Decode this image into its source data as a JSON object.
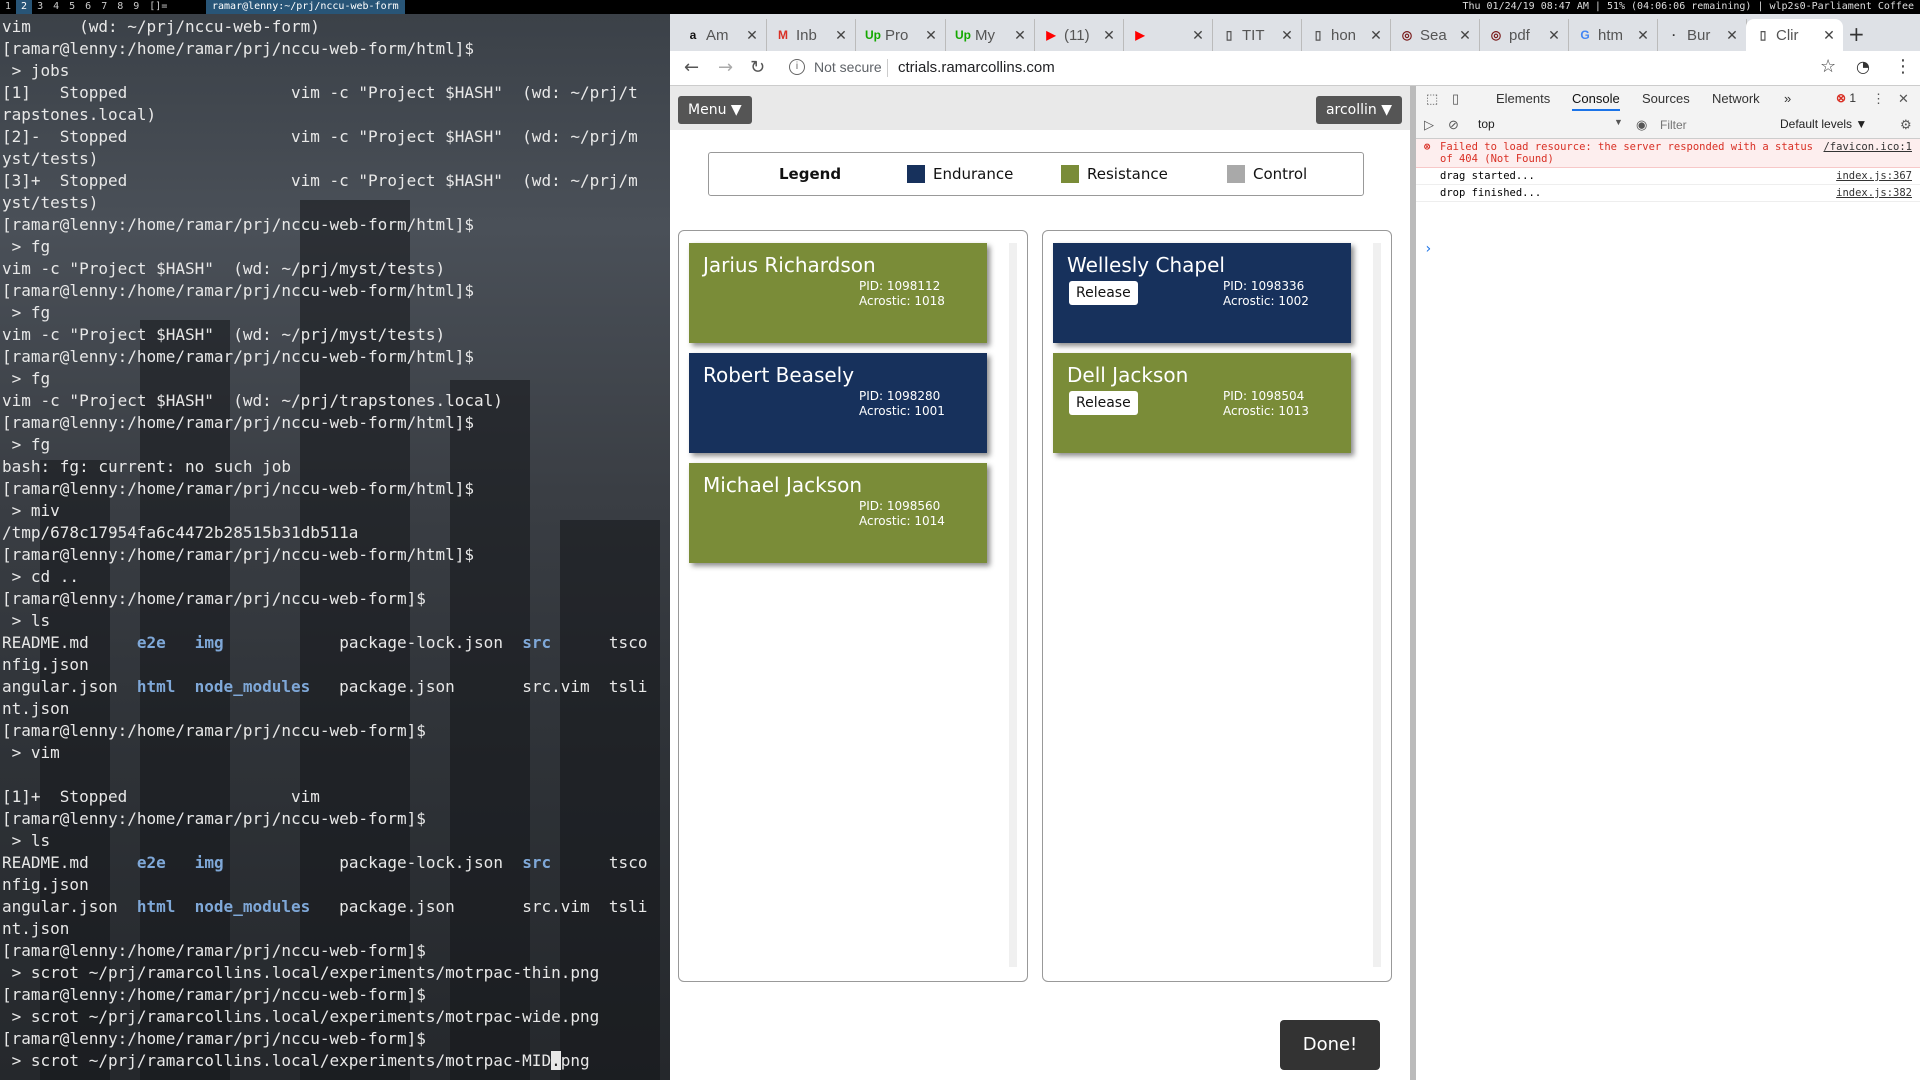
{
  "topbar": {
    "workspaces": [
      "1",
      "2",
      "3",
      "4",
      "5",
      "6",
      "7",
      "8",
      "9",
      "[]="
    ],
    "window_title": "ramar@lenny:~/prj/nccu-web-form",
    "status": "Thu 01/24/19 08:47 AM | 51% (04:06:06 remaining) | wlp2s0-Parliament Coffee"
  },
  "terminal": {
    "lines": [
      "vim     (wd: ~/prj/nccu-web-form)",
      "[ramar@lenny:/home/ramar/prj/nccu-web-form/html]$",
      " > jobs",
      "[1]   Stopped                 vim -c \"Project $HASH\"  (wd: ~/prj/t",
      "rapstones.local)",
      "[2]-  Stopped                 vim -c \"Project $HASH\"  (wd: ~/prj/m",
      "yst/tests)",
      "[3]+  Stopped                 vim -c \"Project $HASH\"  (wd: ~/prj/m",
      "yst/tests)",
      "[ramar@lenny:/home/ramar/prj/nccu-web-form/html]$",
      " > fg",
      "vim -c \"Project $HASH\"  (wd: ~/prj/myst/tests)",
      "[ramar@lenny:/home/ramar/prj/nccu-web-form/html]$",
      " > fg",
      "vim -c \"Project $HASH\"  (wd: ~/prj/myst/tests)",
      "[ramar@lenny:/home/ramar/prj/nccu-web-form/html]$",
      " > fg",
      "vim -c \"Project $HASH\"  (wd: ~/prj/trapstones.local)",
      "[ramar@lenny:/home/ramar/prj/nccu-web-form/html]$",
      " > fg",
      "bash: fg: current: no such job",
      "[ramar@lenny:/home/ramar/prj/nccu-web-form/html]$",
      " > miv",
      "/tmp/678c17954fa6c4472b28515b31db511a",
      "[ramar@lenny:/home/ramar/prj/nccu-web-form/html]$",
      " > cd ..",
      "[ramar@lenny:/home/ramar/prj/nccu-web-form]$",
      " > ls",
      "README.md     e2e   img            package-lock.json  src      tsco",
      "nfig.json",
      "angular.json  html  node_modules   package.json       src.vim  tsli",
      "nt.json",
      "[ramar@lenny:/home/ramar/prj/nccu-web-form]$",
      " > vim",
      "",
      "[1]+  Stopped                 vim",
      "[ramar@lenny:/home/ramar/prj/nccu-web-form]$",
      " > ls",
      "README.md     e2e   img            package-lock.json  src      tsco",
      "nfig.json",
      "angular.json  html  node_modules   package.json       src.vim  tsli",
      "nt.json",
      "[ramar@lenny:/home/ramar/prj/nccu-web-form]$",
      " > scrot ~/prj/ramarcollins.local/experiments/motrpac-thin.png",
      "[ramar@lenny:/home/ramar/prj/nccu-web-form]$",
      " > scrot ~/prj/ramarcollins.local/experiments/motrpac-wide.png",
      "[ramar@lenny:/home/ramar/prj/nccu-web-form]$",
      " > scrot ~/prj/ramarcollins.local/experiments/motrpac-MID.png"
    ],
    "directory_names": [
      "e2e",
      "img",
      "src",
      "html",
      "node_modules"
    ]
  },
  "browser": {
    "tabs": [
      {
        "label": "Am",
        "icon": "amazon-icon"
      },
      {
        "label": "Inb",
        "icon": "gmail-icon"
      },
      {
        "label": "Pro",
        "icon": "upwork-icon"
      },
      {
        "label": "My",
        "icon": "upwork-icon"
      },
      {
        "label": "(11)",
        "icon": "youtube-icon"
      },
      {
        "label": "",
        "icon": "youtube-icon"
      },
      {
        "label": "TIT",
        "icon": "document-icon"
      },
      {
        "label": "hon",
        "icon": "document-icon"
      },
      {
        "label": "Sea",
        "icon": "hidden-eye-icon"
      },
      {
        "label": "pdf",
        "icon": "hidden-eye-icon"
      },
      {
        "label": "htm",
        "icon": "google-icon"
      },
      {
        "label": "Bur",
        "icon": "dot-icon"
      },
      {
        "label": "Clir",
        "icon": "document-icon"
      }
    ],
    "security_label": "Not secure",
    "url": "ctrials.ramarcollins.com"
  },
  "app": {
    "menu_label": "Menu ▼",
    "user_label": "arcollin ▼",
    "legend": {
      "title": "Legend",
      "items": [
        {
          "label": "Endurance",
          "color": "#17315c"
        },
        {
          "label": "Resistance",
          "color": "#7a8c38"
        },
        {
          "label": "Control",
          "color": "#a9a9a9"
        }
      ]
    },
    "left_column": [
      {
        "name": "Jarius Richardson",
        "pid": "PID: 1098112",
        "acrostic": "Acrostic: 1018",
        "group": "Resistance"
      },
      {
        "name": "Robert Beasely",
        "pid": "PID: 1098280",
        "acrostic": "Acrostic: 1001",
        "group": "Endurance"
      },
      {
        "name": "Michael Jackson",
        "pid": "PID: 1098560",
        "acrostic": "Acrostic: 1014",
        "group": "Resistance"
      }
    ],
    "right_column": [
      {
        "name": "Wellesly Chapel",
        "pid": "PID: 1098336",
        "acrostic": "Acrostic: 1002",
        "group": "Endurance",
        "release": "Release"
      },
      {
        "name": "Dell Jackson",
        "pid": "PID: 1098504",
        "acrostic": "Acrostic: 1013",
        "group": "Resistance",
        "release": "Release"
      }
    ],
    "done_label": "Done!"
  },
  "devtools": {
    "tabs": [
      "Elements",
      "Console",
      "Sources",
      "Network"
    ],
    "active_tab": "Console",
    "more": "»",
    "error_count": "1",
    "context": "top",
    "filter_placeholder": "Filter",
    "levels": "Default levels ▼",
    "messages": [
      {
        "text": "Failed to load resource: the server responded with a status of 404 (Not Found)",
        "source": "/favicon.ico:1",
        "level": "error"
      },
      {
        "text": "drag started...",
        "source": "index.js:367",
        "level": "log"
      },
      {
        "text": "drop finished...",
        "source": "index.js:382",
        "level": "log"
      }
    ]
  }
}
